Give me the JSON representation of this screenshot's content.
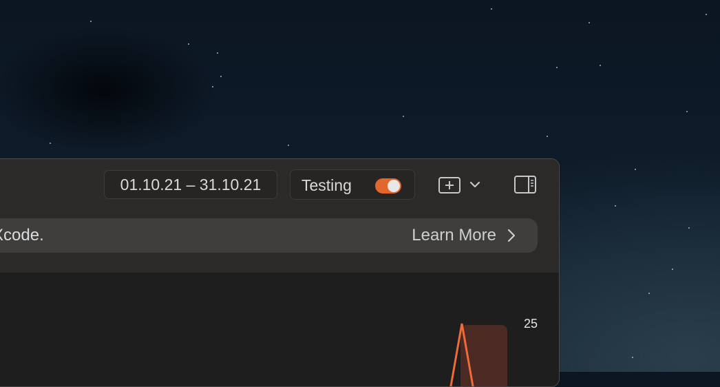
{
  "toolbar": {
    "date_range": "01.10.21 – 31.10.21",
    "testing_label": "Testing",
    "testing_enabled": true,
    "add_icon": "plus-square-icon",
    "dropdown_icon": "chevron-down-icon",
    "sidebar_icon": "sidebar-right-icon"
  },
  "banner": {
    "text": "n Xcode.",
    "learn_more": "Learn More",
    "learn_more_icon": "chevron-right-icon"
  },
  "chart": {
    "y_tick": "25"
  },
  "colors": {
    "accent": "#e2672c",
    "line": "#f06a3a",
    "bar": "#4a2a22"
  }
}
